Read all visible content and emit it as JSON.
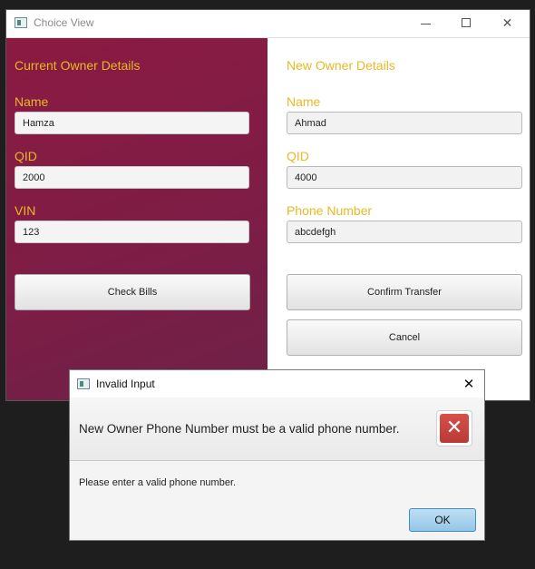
{
  "window": {
    "title": "Choice View",
    "controls": {
      "minimize": "",
      "maximize": "",
      "close": "✕"
    }
  },
  "current_owner": {
    "heading": "Current Owner Details",
    "name_label": "Name",
    "name_value": "Hamza",
    "qid_label": "QID",
    "qid_value": "2000",
    "vin_label": "VIN",
    "vin_value": "123",
    "check_bills_label": "Check Bills"
  },
  "new_owner": {
    "heading": "New Owner Details",
    "name_label": "Name",
    "name_value": "Ahmad",
    "qid_label": "QID",
    "qid_value": "4000",
    "phone_label": "Phone Number",
    "phone_value": "abcdefgh",
    "confirm_label": "Confirm Transfer",
    "cancel_label": "Cancel"
  },
  "dialog": {
    "title": "Invalid Input",
    "close": "✕",
    "header_text": "New Owner Phone Number must be a valid phone number.",
    "error_icon": "✕",
    "content_text": "Please enter a valid phone number.",
    "ok_label": "OK"
  },
  "colors": {
    "accent_label": "#e8b923",
    "left_panel": "#7e1d45",
    "error_icon": "#c9443f",
    "ok_button": "#a8d3ef"
  },
  "icons": {
    "window": "app-window-icon",
    "dialog": "app-window-icon",
    "error": "error-x-icon"
  }
}
